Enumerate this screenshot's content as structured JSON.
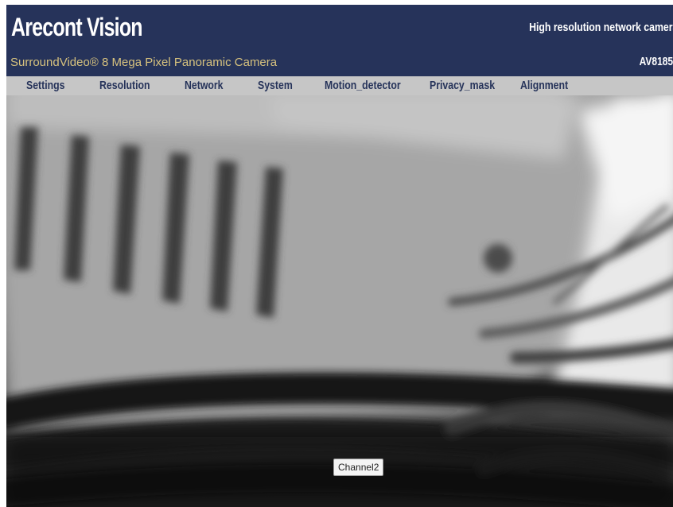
{
  "header": {
    "brand": "Arecont Vision",
    "tagline": "High resolution network camera",
    "product_name": "SurroundVideo® 8 Mega Pixel Panoramic Camera",
    "model": "AV8185"
  },
  "menu": {
    "items": [
      {
        "label": "Settings"
      },
      {
        "label": "Resolution"
      },
      {
        "label": "Network"
      },
      {
        "label": "System"
      },
      {
        "label": "Motion_detector"
      },
      {
        "label": "Privacy_mask"
      },
      {
        "label": "Alignment"
      }
    ]
  },
  "video": {
    "channel_label": "Channel2"
  },
  "colors": {
    "header_bg": "#26335a",
    "menu_bg": "#c6c6c6",
    "menu_text": "#26335a",
    "product_text": "#d7c27e"
  }
}
